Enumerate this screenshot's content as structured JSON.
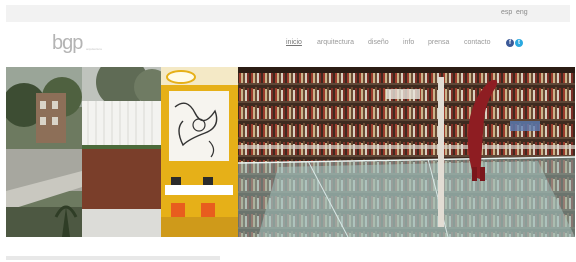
{
  "top_bar": {
    "languages": [
      "esp",
      "eng"
    ]
  },
  "header": {
    "logo_text": "bgp",
    "logo_subtext": "arquitectura",
    "nav": [
      "inicio",
      "arquitectura",
      "diseño",
      "info",
      "prensa",
      "contacto"
    ],
    "active_nav": "inicio",
    "social": [
      {
        "name": "facebook",
        "glyph": "f",
        "color": "#3b5998"
      },
      {
        "name": "twitter",
        "glyph": "t",
        "color": "#2ba9e0"
      }
    ]
  },
  "banner": {
    "panels": [
      "street-view",
      "white-wall-facade",
      "yellow-interior",
      "library-atrium"
    ]
  }
}
